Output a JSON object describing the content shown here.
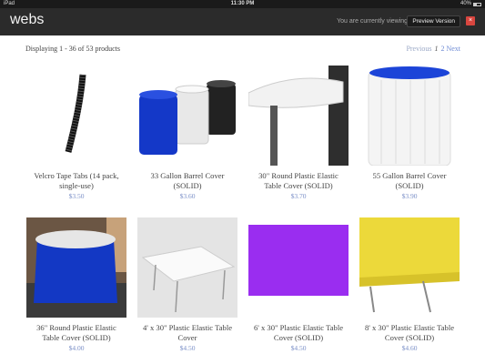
{
  "status_bar": {
    "device": "iPad",
    "time": "11:30 PM",
    "battery": "40%"
  },
  "header": {
    "logo": "webs",
    "viewing_text": "You are currently viewing:",
    "preview_label": "Preview Version",
    "close_label": "×"
  },
  "listing": {
    "display_text": "Displaying 1 - 36 of 53 products",
    "pager": {
      "previous": "Previous",
      "current": "1",
      "next_page": "2",
      "next": "Next"
    }
  },
  "products": [
    {
      "name": "Velcro Tape Tabs (14 pack, single-use)",
      "price": "$3.50",
      "icon": "velcro-tape-image"
    },
    {
      "name": "33 Gallon Barrel Cover (SOLID)",
      "price": "$3.60",
      "icon": "barrel-covers-image"
    },
    {
      "name": "30\" Round Plastic Elastic Table Cover (SOLID)",
      "price": "$3.70",
      "icon": "round-table-cover-image"
    },
    {
      "name": "55 Gallon Barrel Cover (SOLID)",
      "price": "$3.90",
      "icon": "white-barrel-cover-image"
    },
    {
      "name": "36\" Round Plastic Elastic Table Cover (SOLID)",
      "price": "$4.00",
      "icon": "blue-skirted-table-image"
    },
    {
      "name": "4' x 30\" Plastic Elastic Table Cover",
      "price": "$4.50",
      "icon": "white-folding-table-image"
    },
    {
      "name": "6' x 30\" Plastic Elastic Table Cover (SOLID)",
      "price": "$4.50",
      "icon": "purple-table-cover-image"
    },
    {
      "name": "8' x 30\" Plastic Elastic Table Cover (SOLID)",
      "price": "$4.60",
      "icon": "yellow-table-cover-image"
    }
  ]
}
